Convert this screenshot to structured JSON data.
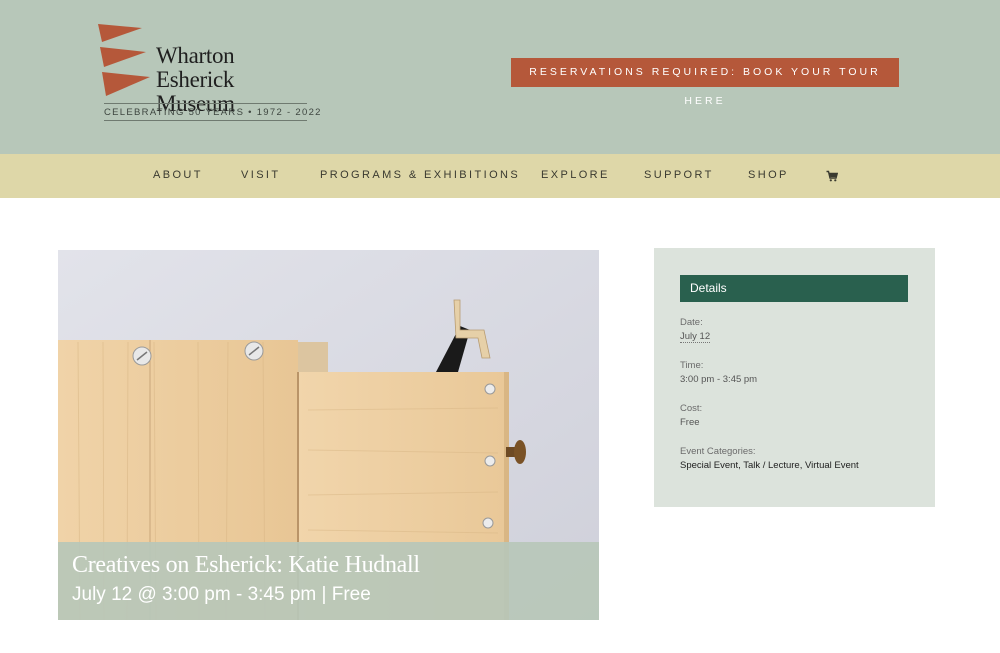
{
  "header": {
    "logo_line1": "Wharton Esherick",
    "logo_line2": "Museum",
    "logo_tagline": "CELEBRATING 50 YEARS • 1972 - 2022",
    "cta_label": "RESERVATIONS REQUIRED: BOOK YOUR TOUR HERE",
    "colors": {
      "header_bg": "#b7c7b9",
      "flag": "#b5583a",
      "cta_bg": "#b5583a"
    }
  },
  "nav": {
    "items": [
      {
        "label": "ABOUT"
      },
      {
        "label": "VISIT"
      },
      {
        "label": "PROGRAMS & EXHIBITIONS"
      },
      {
        "label": "EXPLORE"
      },
      {
        "label": "SUPPORT"
      },
      {
        "label": "SHOP"
      }
    ],
    "cart_icon": "cart-icon",
    "bg_color": "#ded7a8"
  },
  "event": {
    "title": "Creatives on Esherick: Katie Hudnall",
    "subtitle": "July 12 @ 3:00 pm - 3:45 pm | Free"
  },
  "details": {
    "heading": "Details",
    "date_label": "Date:",
    "date_value": "July 12",
    "time_label": "Time:",
    "time_value": "3:00 pm - 3:45 pm",
    "cost_label": "Cost:",
    "cost_value": "Free",
    "categories_label": "Event Categories:",
    "categories": [
      "Special Event",
      "Talk / Lecture",
      "Virtual Event"
    ],
    "heading_bg": "#29604e",
    "panel_bg": "#dce3dc"
  }
}
